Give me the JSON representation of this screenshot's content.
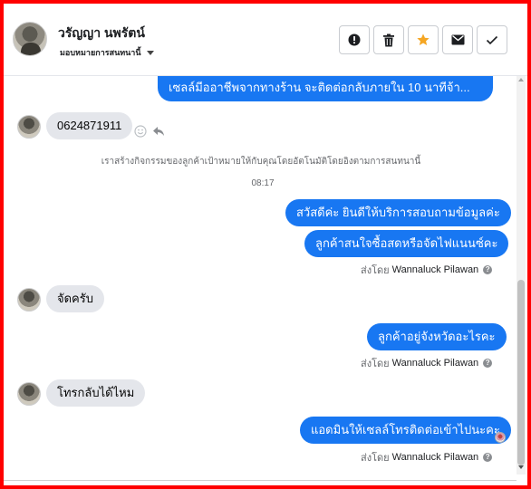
{
  "header": {
    "contact_name": "วรัญญา นพรัตน์",
    "assign_label": "มอบหมายการสนทนานี้"
  },
  "actions": [
    {
      "name": "mark-spam-button",
      "icon": "alert-circle-icon"
    },
    {
      "name": "delete-button",
      "icon": "trash-icon"
    },
    {
      "name": "star-button",
      "icon": "star-icon",
      "color": "#f5a623"
    },
    {
      "name": "mail-button",
      "icon": "mail-icon"
    },
    {
      "name": "done-button",
      "icon": "check-icon"
    }
  ],
  "messages": {
    "m0": "เซลล์มีออาชีพจากทางร้าน จะติดต่อกลับภายใน 10 นาทีจ้า...",
    "m1": "0624871911",
    "system_note": "เราสร้างกิจกรรมของลูกค้าเป้าหมายให้กับคุณโดยอัตโนมัติโดยอิงตามการสนทนานี้",
    "time": "08:17",
    "m2": "สวัสดีค่ะ  ยินดีให้บริการสอบถามข้อมูลค่ะ",
    "m3": "ลูกค้าสนใจซื้อสดหรือจัดไฟแนนซ์คะ",
    "m4": "จัดครับ",
    "m5": "ลูกค้าอยู่จังหวัดอะไรคะ",
    "m6": "โทรกลับได้ไหม",
    "m7": "แอดมินให้เซลล์โทรติดต่อเข้าไปนะคะ"
  },
  "sent_by": {
    "prefix": "ส่งโดย",
    "agent": "Wannaluck Pilawan",
    "help": "?"
  },
  "colors": {
    "outgoing_bubble": "#1877f2",
    "incoming_bubble": "#e4e6eb",
    "frame": "#ff0000"
  }
}
